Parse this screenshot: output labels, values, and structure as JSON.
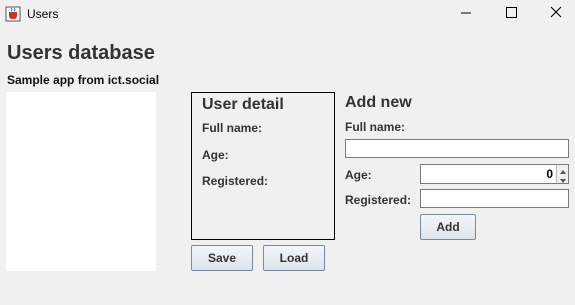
{
  "window": {
    "title": "Users",
    "icons": {
      "app": "java-cup-icon",
      "minimize": "minimize-icon",
      "maximize": "maximize-icon",
      "close": "close-icon"
    }
  },
  "header": {
    "title": "Users database",
    "subtitle": "Sample app from ict.social"
  },
  "user_list": {
    "items": []
  },
  "detail": {
    "title": "User detail",
    "full_name_label": "Full name:",
    "age_label": "Age:",
    "registered_label": "Registered:",
    "save_label": "Save",
    "load_label": "Load"
  },
  "add_new": {
    "title": "Add new",
    "full_name_label": "Full name:",
    "full_name_value": "",
    "age_label": "Age:",
    "age_value": "0",
    "registered_label": "Registered:",
    "registered_value": "",
    "add_label": "Add"
  },
  "colors": {
    "background": "#f0f0f0",
    "text": "#333333",
    "list_background": "#ffffff"
  }
}
